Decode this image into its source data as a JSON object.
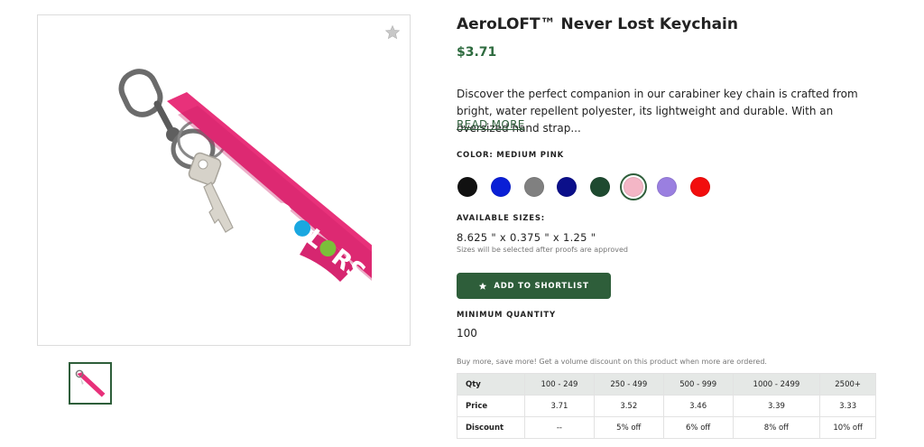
{
  "product": {
    "title": "AeroLOFT™ Never Lost Keychain",
    "price": "$3.71",
    "description": "Discover the perfect companion in our carabiner key chain is crafted from bright, water repellent polyester, its lightweight and durable. With an oversized hand strap...",
    "read_more": "READ MORE",
    "logo_text": "COLORS"
  },
  "color": {
    "label": "COLOR: MEDIUM PINK",
    "swatches": [
      {
        "name": "Black",
        "hex": "#111111"
      },
      {
        "name": "Royal Blue",
        "hex": "#0a1fd6"
      },
      {
        "name": "Gray",
        "hex": "#808080"
      },
      {
        "name": "Navy",
        "hex": "#0b0f8a"
      },
      {
        "name": "Forest Green",
        "hex": "#1e4a30"
      },
      {
        "name": "Medium Pink",
        "hex": "#f4b6c6",
        "selected": true
      },
      {
        "name": "Purple",
        "hex": "#9a7fe0"
      },
      {
        "name": "Red",
        "hex": "#f20d0d"
      }
    ]
  },
  "sizes": {
    "label": "AVAILABLE SIZES:",
    "value": "8.625 \" x 0.375 \" x 1.25 \"",
    "note": "Sizes will be selected after proofs are approved"
  },
  "actions": {
    "shortlist_label": "ADD TO SHORTLIST"
  },
  "minimum": {
    "label": "MINIMUM QUANTITY",
    "value": "100"
  },
  "volume": {
    "note": "Buy more, save more! Get a volume discount on this product when more are ordered.",
    "headers": [
      "Qty",
      "100 - 249",
      "250 - 499",
      "500 - 999",
      "1000 - 2499",
      "2500+"
    ],
    "rows": [
      [
        "Price",
        "3.71",
        "3.52",
        "3.46",
        "3.39",
        "3.33"
      ],
      [
        "Discount",
        "--",
        "5% off",
        "6% off",
        "8% off",
        "10% off"
      ]
    ]
  },
  "theme": {
    "accent": "#2e5e3a",
    "price_color": "#2e6b3f",
    "strap_color": "#e8317a"
  },
  "icons": {
    "favorite": "star-icon",
    "shortlist": "star-icon"
  }
}
